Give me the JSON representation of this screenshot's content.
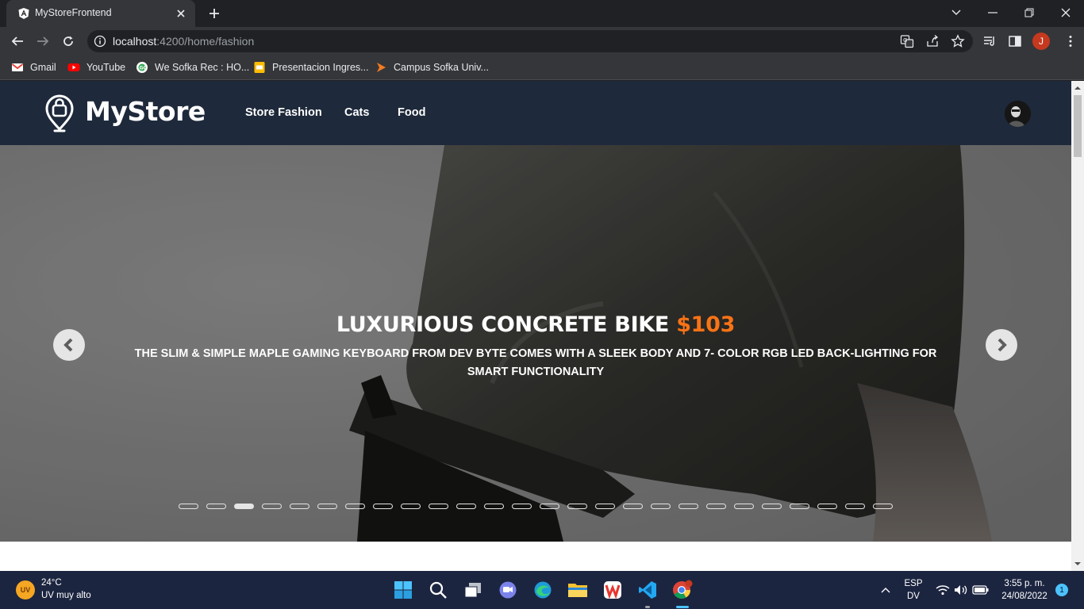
{
  "browser": {
    "tab_title": "MyStoreFrontend",
    "url_host": "localhost",
    "url_rest": ":4200/home/fashion",
    "profile_initial": "J"
  },
  "bookmarks": [
    {
      "label": "Gmail",
      "icon": "gmail-icon"
    },
    {
      "label": "YouTube",
      "icon": "youtube-icon"
    },
    {
      "label": "We Sofka Rec : HO...",
      "icon": "sofka-icon"
    },
    {
      "label": "Presentacion Ingres...",
      "icon": "slides-icon"
    },
    {
      "label": "Campus Sofka Univ...",
      "icon": "campus-icon"
    }
  ],
  "navbar": {
    "brand": "MyStore",
    "links": [
      "Store Fashion",
      "Cats",
      "Food"
    ]
  },
  "carousel": {
    "title": "LUXURIOUS CONCRETE BIKE",
    "price": "$103",
    "description": "THE SLIM & SIMPLE MAPLE GAMING KEYBOARD FROM DEV BYTE COMES WITH A SLEEK BODY AND 7- COLOR RGB LED BACK-LIGHTING FOR SMART FUNCTIONALITY",
    "slide_count": 26,
    "active_slide": 3
  },
  "taskbar": {
    "weather_temp": "24°C",
    "weather_desc": "UV muy alto",
    "weather_badge": "UV",
    "lang_top": "ESP",
    "lang_bottom": "DV",
    "time": "3:55 p. m.",
    "date": "24/08/2022",
    "notifications": "1"
  },
  "colors": {
    "navbar_bg": "#1e293b",
    "price_accent": "#f97316"
  }
}
